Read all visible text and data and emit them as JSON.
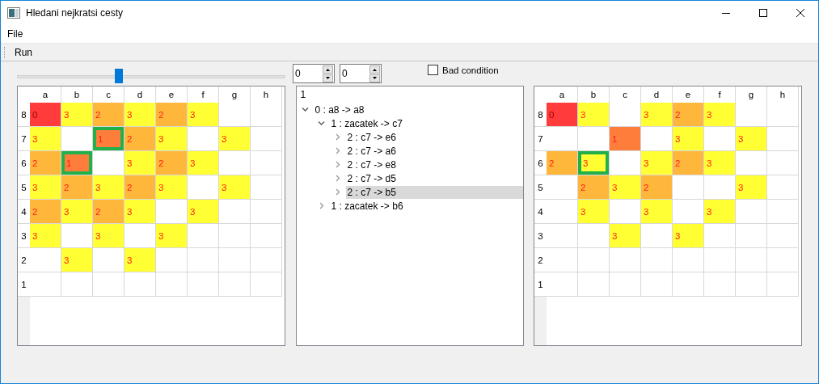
{
  "window": {
    "title": "Hledani nejkratsi cesty"
  },
  "menu": [
    "File"
  ],
  "toolbar": [
    "Run"
  ],
  "slider": {
    "level": 0.38
  },
  "spinboxes": [
    {
      "value": "0"
    },
    {
      "value": "0"
    }
  ],
  "checkbox": {
    "label": "Bad condition",
    "checked": false
  },
  "left_grid": {
    "columns": [
      "a",
      "b",
      "c",
      "d",
      "e",
      "f",
      "g",
      "h"
    ],
    "rows": [
      {
        "label": "8",
        "cells": [
          {
            "value": "0",
            "outlined": false
          },
          {
            "value": "3",
            "outlined": false
          },
          {
            "value": "2",
            "outlined": false
          },
          {
            "value": "3",
            "outlined": false
          },
          {
            "value": "2",
            "outlined": false
          },
          {
            "value": "3",
            "outlined": false
          },
          {
            "outlined": false
          },
          {
            "outlined": false
          }
        ]
      },
      {
        "label": "7",
        "cells": [
          {
            "value": "3",
            "outlined": false
          },
          {
            "outlined": false
          },
          {
            "value": "1",
            "outlined": true
          },
          {
            "value": "2",
            "outlined": false
          },
          {
            "value": "3",
            "outlined": false
          },
          {
            "outlined": false
          },
          {
            "value": "3",
            "outlined": false
          },
          {
            "outlined": false
          }
        ]
      },
      {
        "label": "6",
        "cells": [
          {
            "value": "2",
            "outlined": false
          },
          {
            "value": "1",
            "outlined": true
          },
          {
            "outlined": false
          },
          {
            "value": "3",
            "outlined": false
          },
          {
            "value": "2",
            "outlined": false
          },
          {
            "value": "3",
            "outlined": false
          },
          {
            "outlined": false
          },
          {
            "outlined": false
          }
        ]
      },
      {
        "label": "5",
        "cells": [
          {
            "value": "3",
            "outlined": false
          },
          {
            "value": "2",
            "outlined": false
          },
          {
            "value": "3",
            "outlined": false
          },
          {
            "value": "2",
            "outlined": false
          },
          {
            "value": "3",
            "outlined": false
          },
          {
            "outlined": false
          },
          {
            "value": "3",
            "outlined": false
          },
          {
            "outlined": false
          }
        ]
      },
      {
        "label": "4",
        "cells": [
          {
            "value": "2",
            "outlined": false
          },
          {
            "value": "3",
            "outlined": false
          },
          {
            "value": "2",
            "outlined": false
          },
          {
            "value": "3",
            "outlined": false
          },
          {
            "outlined": false
          },
          {
            "value": "3",
            "outlined": false
          },
          {
            "outlined": false
          },
          {
            "outlined": false
          }
        ]
      },
      {
        "label": "3",
        "cells": [
          {
            "value": "3",
            "outlined": false
          },
          {
            "outlined": false
          },
          {
            "value": "3",
            "outlined": false
          },
          {
            "outlined": false
          },
          {
            "value": "3",
            "outlined": false
          },
          {
            "outlined": false
          },
          {
            "outlined": false
          },
          {
            "outlined": false
          }
        ]
      },
      {
        "label": "2",
        "cells": [
          {
            "outlined": false
          },
          {
            "value": "3",
            "outlined": false
          },
          {
            "outlined": false
          },
          {
            "value": "3",
            "outlined": false
          },
          {
            "outlined": false
          },
          {
            "outlined": false
          },
          {
            "outlined": false
          },
          {
            "outlined": false
          }
        ]
      },
      {
        "label": "1",
        "cells": [
          {
            "outlined": false
          },
          {
            "outlined": false
          },
          {
            "outlined": false
          },
          {
            "outlined": false
          },
          {
            "outlined": false
          },
          {
            "outlined": false
          },
          {
            "outlined": false
          },
          {
            "outlined": false
          }
        ]
      }
    ]
  },
  "tree": {
    "header": "1",
    "items": [
      {
        "label": "0 : a8 -> a8",
        "expanded": true,
        "selected": false,
        "children": [
          {
            "label": "1 : zacatek -> c7",
            "expanded": true,
            "selected": false,
            "children": [
              {
                "label": "2 : c7 -> e6",
                "expanded": false,
                "selected": false
              },
              {
                "label": "2 : c7 -> a6",
                "expanded": false,
                "selected": false
              },
              {
                "label": "2 : c7 -> e8",
                "expanded": false,
                "selected": false
              },
              {
                "label": "2 : c7 -> d5",
                "expanded": false,
                "selected": false
              },
              {
                "label": "2 : c7 -> b5",
                "expanded": false,
                "selected": true
              }
            ]
          },
          {
            "label": "1 : zacatek -> b6",
            "expanded": false,
            "selected": false
          }
        ]
      }
    ]
  },
  "right_grid": {
    "columns": [
      "a",
      "b",
      "c",
      "d",
      "e",
      "f",
      "g",
      "h"
    ],
    "rows": [
      {
        "label": "8",
        "cells": [
          {
            "value": "0",
            "outlined": false
          },
          {
            "value": "3",
            "outlined": false
          },
          {
            "outlined": false
          },
          {
            "value": "3",
            "outlined": false
          },
          {
            "value": "2",
            "outlined": false
          },
          {
            "value": "3",
            "outlined": false
          },
          {
            "outlined": false
          },
          {
            "outlined": false
          }
        ]
      },
      {
        "label": "7",
        "cells": [
          {
            "outlined": false
          },
          {
            "outlined": false
          },
          {
            "value": "1",
            "outlined": false
          },
          {
            "outlined": false
          },
          {
            "value": "3",
            "outlined": false
          },
          {
            "outlined": false
          },
          {
            "value": "3",
            "outlined": false
          },
          {
            "outlined": false
          }
        ]
      },
      {
        "label": "6",
        "cells": [
          {
            "value": "2",
            "outlined": false
          },
          {
            "value": "3",
            "outlined": true
          },
          {
            "outlined": false
          },
          {
            "value": "3",
            "outlined": false
          },
          {
            "value": "2",
            "outlined": false
          },
          {
            "value": "3",
            "outlined": false
          },
          {
            "outlined": false
          },
          {
            "outlined": false
          }
        ]
      },
      {
        "label": "5",
        "cells": [
          {
            "outlined": false
          },
          {
            "value": "2",
            "outlined": false
          },
          {
            "value": "3",
            "outlined": false
          },
          {
            "value": "2",
            "outlined": false
          },
          {
            "outlined": false
          },
          {
            "outlined": false
          },
          {
            "value": "3",
            "outlined": false
          },
          {
            "outlined": false
          }
        ]
      },
      {
        "label": "4",
        "cells": [
          {
            "outlined": false
          },
          {
            "value": "3",
            "outlined": false
          },
          {
            "outlined": false
          },
          {
            "value": "3",
            "outlined": false
          },
          {
            "outlined": false
          },
          {
            "value": "3",
            "outlined": false
          },
          {
            "outlined": false
          },
          {
            "outlined": false
          }
        ]
      },
      {
        "label": "3",
        "cells": [
          {
            "outlined": false
          },
          {
            "outlined": false
          },
          {
            "value": "3",
            "outlined": false
          },
          {
            "outlined": false
          },
          {
            "value": "3",
            "outlined": false
          },
          {
            "outlined": false
          },
          {
            "outlined": false
          },
          {
            "outlined": false
          }
        ]
      },
      {
        "label": "2",
        "cells": [
          {
            "outlined": false
          },
          {
            "outlined": false
          },
          {
            "outlined": false
          },
          {
            "outlined": false
          },
          {
            "outlined": false
          },
          {
            "outlined": false
          },
          {
            "outlined": false
          },
          {
            "outlined": false
          }
        ]
      },
      {
        "label": "1",
        "cells": [
          {
            "outlined": false
          },
          {
            "outlined": false
          },
          {
            "outlined": false
          },
          {
            "outlined": false
          },
          {
            "outlined": false
          },
          {
            "outlined": false
          },
          {
            "outlined": false
          },
          {
            "outlined": false
          }
        ]
      }
    ]
  }
}
